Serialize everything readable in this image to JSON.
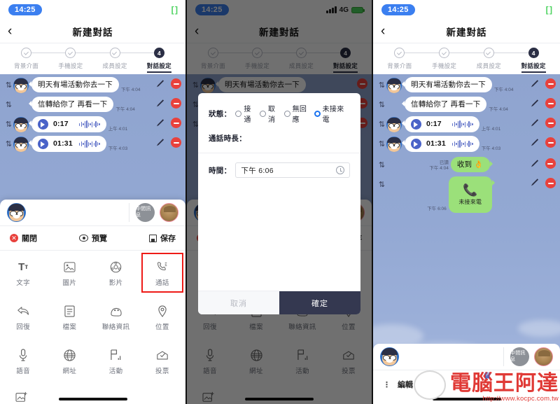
{
  "status_bar": {
    "time": "14:25",
    "network": "4G"
  },
  "nav": {
    "title": "新建對話",
    "back_icon": "chevron-left-icon"
  },
  "stepper": {
    "steps": [
      {
        "label": "背景介面",
        "state": "done",
        "marker": "✓"
      },
      {
        "label": "手機設定",
        "state": "done",
        "marker": "✓"
      },
      {
        "label": "成員設定",
        "state": "done",
        "marker": "✓"
      },
      {
        "label": "對話設定",
        "state": "current",
        "marker": "4"
      }
    ]
  },
  "messages": [
    {
      "type": "text",
      "side": "left",
      "text": "明天有場活動你去一下",
      "time": "下午 4:04",
      "avatar": true
    },
    {
      "type": "text",
      "side": "left",
      "text": "信轉給你了 再看一下",
      "time": "下午 4:04",
      "avatar": false
    },
    {
      "type": "voice",
      "side": "left",
      "duration": "0:17",
      "time": "上午 4:01",
      "avatar": true
    },
    {
      "type": "voice",
      "side": "left",
      "duration": "01:31",
      "time": "下午 4:03",
      "avatar": true
    },
    {
      "type": "text",
      "side": "right",
      "text": "收到 👌",
      "time": "下午 4:04",
      "read": "已讀",
      "avatar": false
    },
    {
      "type": "call",
      "side": "right",
      "label": "未接來電",
      "time": "下午 6:06",
      "icon": "phone-icon",
      "avatar": false
    }
  ],
  "sheet": {
    "header": {
      "middle_message_label": "中間訊息"
    },
    "actions": [
      {
        "label": "關閉",
        "icon": "close-circle-icon"
      },
      {
        "label": "預覽",
        "icon": "eye-icon"
      },
      {
        "label": "保存",
        "icon": "save-icon"
      }
    ],
    "tools": [
      {
        "label": "文字",
        "icon": "text-icon",
        "glyph": "Tт",
        "highlighted": false
      },
      {
        "label": "圖片",
        "icon": "image-icon",
        "glyph": "🖾",
        "highlighted": false
      },
      {
        "label": "影片",
        "icon": "video-icon",
        "glyph": "◎",
        "highlighted": false
      },
      {
        "label": "通話",
        "icon": "phone-call-icon",
        "glyph": "✆",
        "highlighted": true
      },
      {
        "label": "回復",
        "icon": "reply-icon",
        "glyph": "↩",
        "highlighted": false
      },
      {
        "label": "檔案",
        "icon": "file-icon",
        "glyph": "🗎",
        "highlighted": false
      },
      {
        "label": "聯絡資訊",
        "icon": "contact-card-icon",
        "glyph": "👤",
        "highlighted": false
      },
      {
        "label": "位置",
        "icon": "location-pin-icon",
        "glyph": "◉",
        "highlighted": false
      },
      {
        "label": "語音",
        "icon": "microphone-icon",
        "glyph": "🎙",
        "highlighted": false
      },
      {
        "label": "網址",
        "icon": "globe-icon",
        "glyph": "🌐",
        "highlighted": false
      },
      {
        "label": "活動",
        "icon": "event-icon",
        "glyph": "⚑",
        "highlighted": false
      },
      {
        "label": "投票",
        "icon": "poll-icon",
        "glyph": "✉",
        "highlighted": false
      }
    ],
    "extra_tool": {
      "label": "圖片相簿",
      "icon": "add-photo-icon"
    }
  },
  "modal": {
    "state_label": "狀態：",
    "state_options": [
      {
        "label": "接通",
        "selected": false
      },
      {
        "label": "取消",
        "selected": false
      },
      {
        "label": "無回應",
        "selected": false
      },
      {
        "label": "未接來電",
        "selected": true
      }
    ],
    "duration_label": "通話時長：",
    "time_label": "時間：",
    "time_value": "下午 6:06",
    "time_icon": "clock-icon",
    "cancel_label": "取消",
    "confirm_label": "確定"
  },
  "p3_bottom": {
    "edit_label": "編輯"
  },
  "watermark": {
    "main": "電腦王阿達",
    "url": "http://www.kocpc.com.tw"
  },
  "colors": {
    "accent_blue": "#3b7ff0",
    "bubble_green": "#9be07a",
    "delete_red": "#e8413c",
    "highlight_red": "#ee1b17",
    "dark_navy": "#2b2f45",
    "chat_bg": "#93a8d3"
  }
}
